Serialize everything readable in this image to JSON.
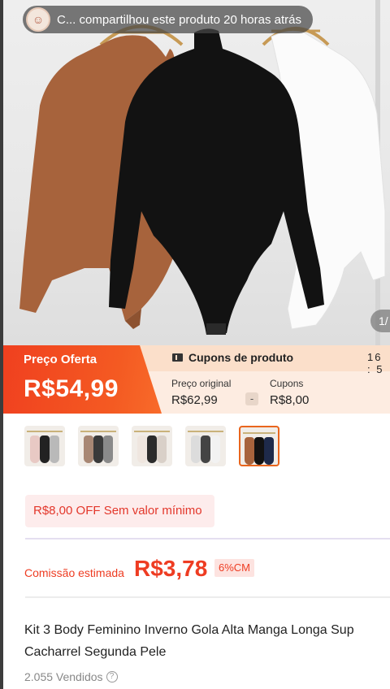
{
  "share": {
    "text": "C... compartilhou este produto 20 horas atrás",
    "avatar_icon": "user-avatar-icon"
  },
  "image_counter": "1/",
  "price": {
    "label": "Preço Oferta",
    "value": "R$54,99"
  },
  "coupons": {
    "title": "Cupons de produto",
    "timer": "16 : 5",
    "original_label": "Preço original",
    "original_value": "R$62,99",
    "minus": "-",
    "coupon_label": "Cupons",
    "coupon_value": "R$8,00"
  },
  "promo": "R$8,00 OFF Sem valor mínimo",
  "commission": {
    "label": "Comissão estimada",
    "value": "R$3,78",
    "badge": "6%CM"
  },
  "product": {
    "title_line1": "Kit 3 Body Feminino Inverno Gola Alta Manga Longa Sup",
    "title_line2": "Cacharrel Segunda Pele",
    "sold": "2.055 Vendidos"
  },
  "colors": {
    "accent": "#f0401f",
    "commission": "#ee3c22",
    "coupon_bg": "#fdece1"
  }
}
